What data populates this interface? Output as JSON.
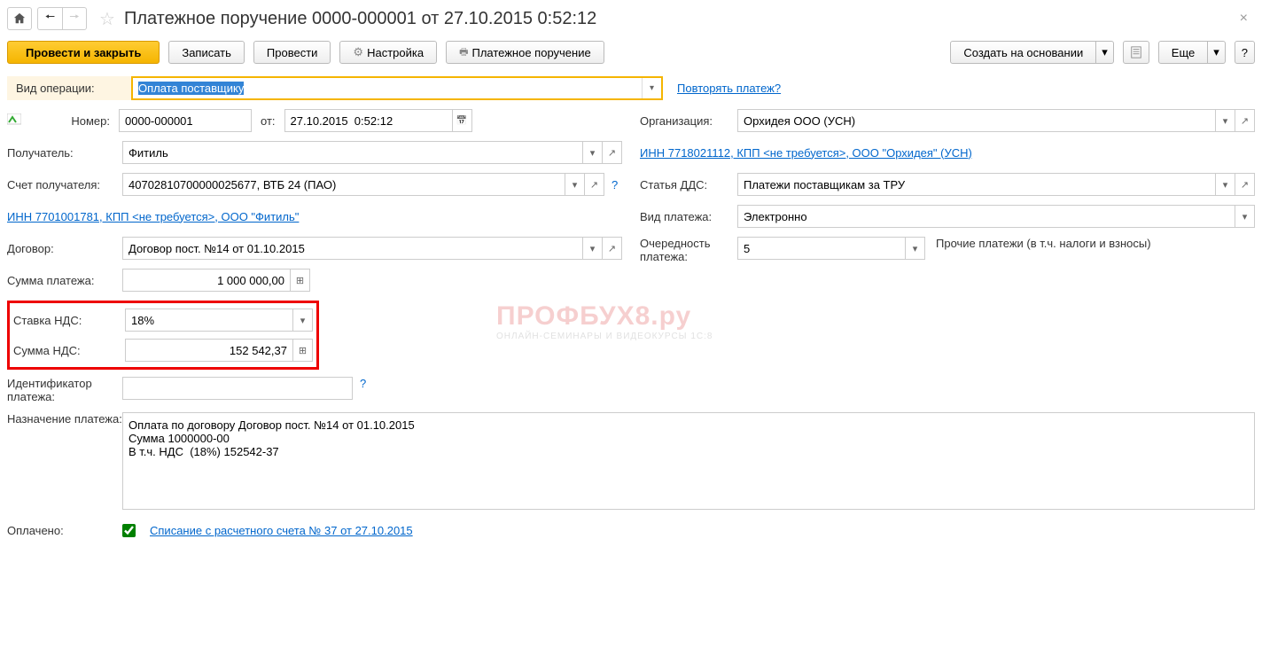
{
  "window_title": "Платежное поручение 0000-000001 от 27.10.2015 0:52:12",
  "cmdbar": {
    "primary": "Провести и закрыть",
    "save": "Записать",
    "post": "Провести",
    "settings": "Настройка",
    "print": "Платежное поручение",
    "create_based": "Создать на основании",
    "more": "Еще"
  },
  "labels": {
    "op_type": "Вид операции:",
    "number": "Номер:",
    "from": "от:",
    "recipient": "Получатель:",
    "recip_account": "Счет получателя:",
    "contract": "Договор:",
    "pay_sum": "Сумма платежа:",
    "vat_rate": "Ставка НДС:",
    "vat_sum": "Сумма НДС:",
    "pay_id": "Идентификатор платежа:",
    "purpose": "Назначение платежа:",
    "paid": "Оплачено:",
    "org": "Организация:",
    "dds": "Статья ДДС:",
    "pay_kind": "Вид платежа:",
    "priority": "Очередность платежа:"
  },
  "values": {
    "op_type": "Оплата поставщику",
    "number": "0000-000001",
    "date": "27.10.2015  0:52:12",
    "recipient": "Фитиль",
    "recip_account": "40702810700000025677, ВТБ 24 (ПАО)",
    "contract": "Договор пост. №14 от 01.10.2015",
    "pay_sum": "1 000 000,00",
    "vat_rate": "18%",
    "vat_sum": "152 542,37",
    "pay_id": "",
    "purpose": "Оплата по договору Договор пост. №14 от 01.10.2015\nСумма 1000000-00\nВ т.ч. НДС  (18%) 152542-37",
    "org": "Орхидея ООО (УСН)",
    "dds": "Платежи поставщикам за ТРУ",
    "pay_kind": "Электронно",
    "priority": "5",
    "priority_desc": "Прочие платежи (в т.ч. налоги и взносы)"
  },
  "links": {
    "repeat": "Повторять платеж?",
    "recip_info": "ИНН 7701001781, КПП <не требуется>, ООО \"Фитиль\"",
    "org_info": "ИНН 7718021112, КПП <не требуется>, ООО \"Орхидея\" (УСН)",
    "paid_link": "Списание с расчетного счета № 37 от 27.10.2015"
  },
  "watermark": {
    "main": "ПРОФБУХ8.ру",
    "sub": "ОНЛАЙН-СЕМИНАРЫ И ВИДЕОКУРСЫ 1С:8"
  }
}
